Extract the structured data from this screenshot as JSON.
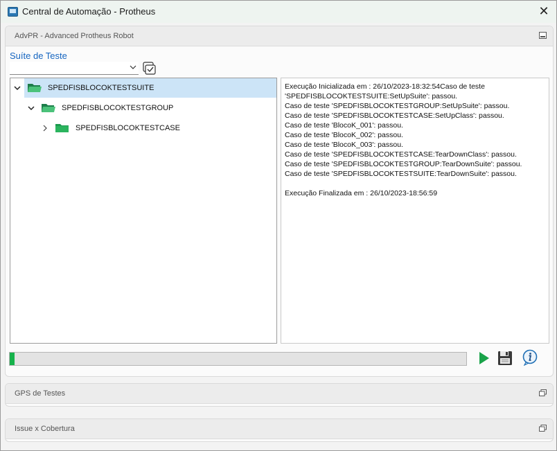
{
  "window": {
    "title": "Central de Automação - Protheus",
    "close_glyph": "✕"
  },
  "advpr_panel": {
    "title": "AdvPR - Advanced Protheus Robot",
    "suite_label": "Suíte de Teste",
    "suite_select_value": "",
    "tree": [
      {
        "label": "SPEDFISBLOCOKTESTSUITE",
        "expanded": true,
        "selected": true,
        "icon": "open-folder-icon"
      },
      {
        "label": "SPEDFISBLOCOKTESTGROUP",
        "expanded": true,
        "selected": false,
        "icon": "open-folder-icon"
      },
      {
        "label": "SPEDFISBLOCOKTESTCASE",
        "expanded": false,
        "selected": false,
        "icon": "folder-icon"
      }
    ],
    "log_lines": [
      "Execução Inicializada em : 26/10/2023-18:32:54Caso de teste",
      "'SPEDFISBLOCOKTESTSUITE:SetUpSuite': passou.",
      "Caso de teste 'SPEDFISBLOCOKTESTGROUP:SetUpSuite': passou.",
      "Caso de teste 'SPEDFISBLOCOKTESTCASE:SetUpClass': passou.",
      "Caso de teste 'BlocoK_001': passou.",
      "Caso de teste 'BlocoK_002': passou.",
      "Caso de teste 'BlocoK_003': passou.",
      "Caso de teste 'SPEDFISBLOCOKTESTCASE:TearDownClass': passou.",
      "Caso de teste 'SPEDFISBLOCOKTESTGROUP:TearDownSuite': passou.",
      "Caso de teste 'SPEDFISBLOCOKTESTSUITE:TearDownSuite': passou.",
      "",
      "Execução Finalizada em : 26/10/2023-18:56:59"
    ],
    "progress_fraction": 0.01,
    "colors": {
      "progress": "#16b24b",
      "play": "#1aa34a",
      "info": "#1f6fb5",
      "accent_text": "#1565c0",
      "selection": "#cce4f7"
    }
  },
  "gps_panel": {
    "title": "GPS de Testes"
  },
  "issue_panel": {
    "title": "Issue x Cobertura"
  }
}
